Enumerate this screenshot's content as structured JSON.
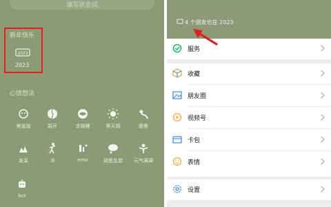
{
  "left": {
    "status_placeholder": "填写状态词",
    "new_year": {
      "title": "新年快乐",
      "badge_text": "2023",
      "label": "2023"
    },
    "mood": {
      "title": "心情想法",
      "items": [
        {
          "label": "美滋滋",
          "icon": "flower-smile-icon"
        },
        {
          "label": "裂开",
          "icon": "cracked-face-icon"
        },
        {
          "label": "求锦鲤",
          "icon": "koi-fish-icon"
        },
        {
          "label": "等天晴",
          "icon": "sun-icon"
        },
        {
          "label": "疲惫",
          "icon": "tired-person-icon"
        },
        {
          "label": "发呆",
          "icon": "daze-icon"
        },
        {
          "label": "冲",
          "icon": "running-icon"
        },
        {
          "label": "emo",
          "icon": "emo-icon"
        },
        {
          "label": "胡思乱想",
          "icon": "thought-cloud-icon"
        },
        {
          "label": "元气满满",
          "icon": "energy-icon"
        },
        {
          "label": "bot",
          "icon": "robot-icon"
        }
      ]
    }
  },
  "right": {
    "header": {
      "friends_text": "4 个朋友也在 2023",
      "friends_icon": "badge-2023-icon"
    },
    "menu_groups": [
      [
        {
          "label": "服务",
          "icon": "service-check-icon",
          "color": "#07c160"
        }
      ],
      [
        {
          "label": "收藏",
          "icon": "favorites-cube-icon",
          "color": "#f2a93b"
        },
        {
          "label": "朋友圈",
          "icon": "moments-image-icon",
          "color": "#3e8ef7"
        },
        {
          "label": "视频号",
          "icon": "channels-icon",
          "color": "#f2a93b"
        },
        {
          "label": "卡包",
          "icon": "card-wallet-icon",
          "color": "#3e8ef7"
        },
        {
          "label": "表情",
          "icon": "sticker-smile-icon",
          "color": "#f2a93b"
        }
      ],
      [
        {
          "label": "设置",
          "icon": "settings-gear-icon",
          "color": "#3e8ef7"
        }
      ]
    ]
  },
  "colors": {
    "annotation_red": "#e02020",
    "olive_bg": "#8a9b76",
    "wechat_green": "#07c160"
  }
}
